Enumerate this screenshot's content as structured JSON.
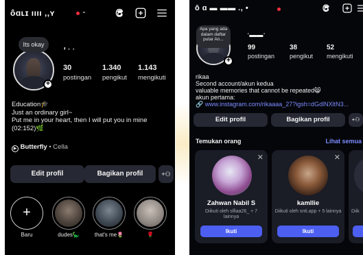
{
  "left": {
    "username": "ôɑʟɪ​​ ıııı ,,ʏ",
    "topbar_icons": [
      "threads-icon",
      "add-post-icon",
      "menu-icon"
    ],
    "note": "Its okay",
    "display_name": "ꞌ ˑ ˑ",
    "stats": [
      {
        "num": "30",
        "label": "postingan"
      },
      {
        "num": "1.340",
        "label": "pengikut"
      },
      {
        "num": "1.143",
        "label": "mengikuti"
      }
    ],
    "bio_category": "Education🎓",
    "bio_lines": [
      "Just an ordinary girl~",
      "Put me in your heart, then I will put you in mine",
      "(02:152)🌿"
    ],
    "music_title": "Butterfly",
    "music_artist": " • Cella",
    "edit_label": "Edit profil",
    "share_label": "Bagikan profil",
    "highlights": [
      {
        "caption": "Baru"
      },
      {
        "caption": "dudes🦕"
      },
      {
        "caption": "that's me🌷"
      },
      {
        "caption": "🌹"
      }
    ]
  },
  "right": {
    "username": "ô ɑ ▬ ▬▬ ., •",
    "note": "Apa yang ada dalam daftar putar An...",
    "display_name": "ˑ▬▬ˑ",
    "stats": [
      {
        "num": "99",
        "label": "postingan"
      },
      {
        "num": "38",
        "label": "pengikut"
      },
      {
        "num": "52",
        "label": "mengikuti"
      }
    ],
    "bio_lines": [
      "rikaa",
      "Second account/akun kedua",
      "valuable memories that cannot be repeated😸",
      "akun pertama:"
    ],
    "link": "www.instagram.com/rikaaaa_27?igsh=dGdlNXltN3...",
    "edit_label": "Edit profil",
    "share_label": "Bagikan profil",
    "suggest_title": "Temukan orang",
    "see_all": "Lihat semua",
    "cards": [
      {
        "name": "Zahwan Nabil S",
        "sub": "Diikuti oleh slfiaa26_ + 7 lainnya",
        "follow": "Ikuti"
      },
      {
        "name": "kamllie",
        "sub": "Diikuti oleh snti.app + 5 lainnya",
        "follow": "Ikuti"
      },
      {
        "name": "",
        "sub": "Diik",
        "follow": "I"
      }
    ]
  },
  "colors": {
    "background": "#000000",
    "button": "#262833",
    "follow_blue": "#4c5ff0",
    "link_blue": "#7c8cff",
    "notification": "#ff3040"
  }
}
